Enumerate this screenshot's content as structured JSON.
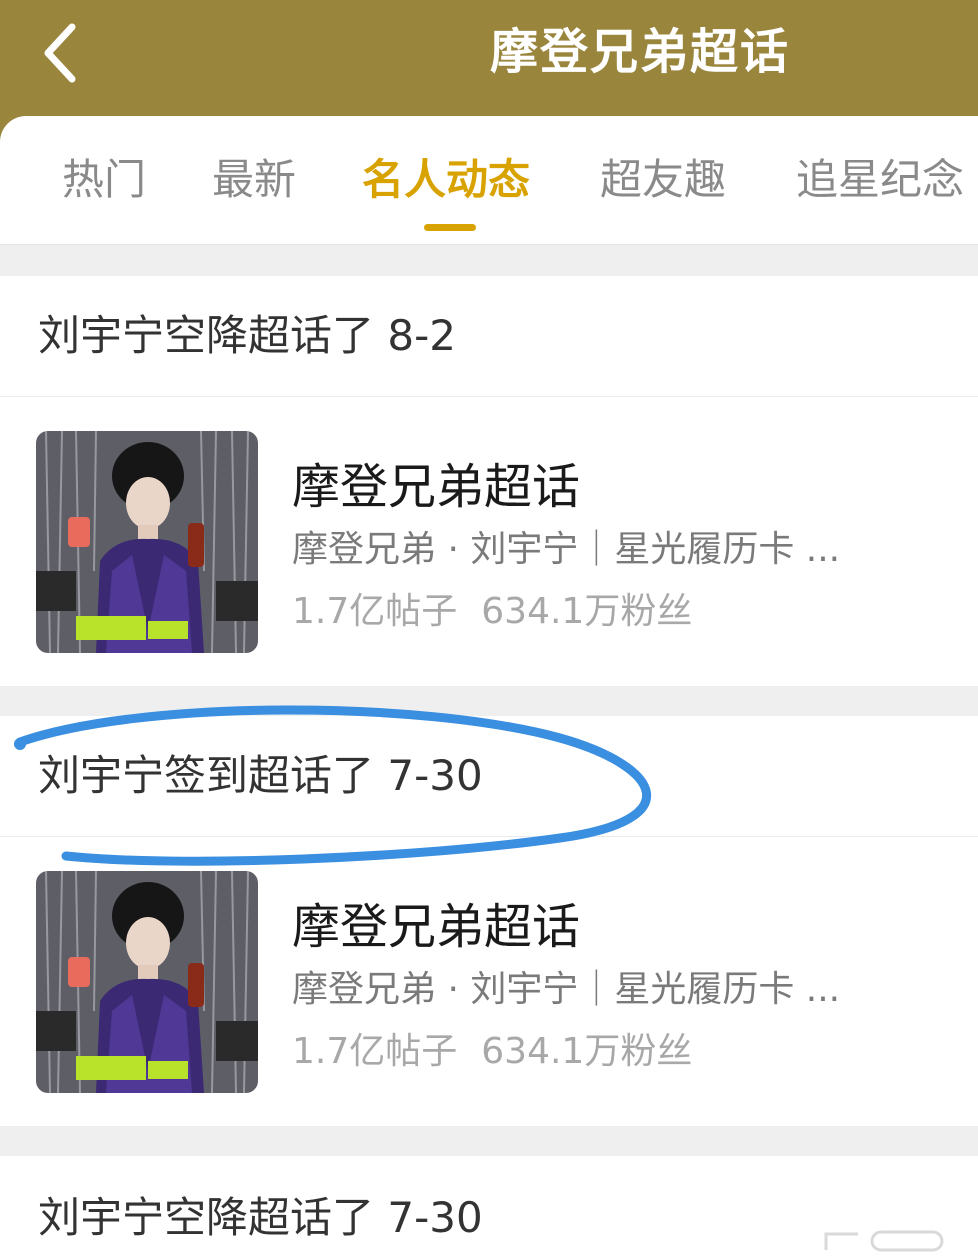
{
  "header": {
    "title": "摩登兄弟超话"
  },
  "tabs": [
    {
      "label": "热门"
    },
    {
      "label": "最新"
    },
    {
      "label": "名人动态"
    },
    {
      "label": "超友趣"
    },
    {
      "label": "追星纪念"
    }
  ],
  "active_tab": "名人动态",
  "sections": [
    {
      "heading": "刘宇宁空降超话了 8-2",
      "item": {
        "title": "摩登兄弟超话",
        "subtitle": "摩登兄弟 · 刘宇宁｜星光履历卡 ...",
        "posts": "1.7亿帖子",
        "fans": "634.1万粉丝"
      }
    },
    {
      "heading": "刘宇宁签到超话了 7-30",
      "item": {
        "title": "摩登兄弟超话",
        "subtitle": "摩登兄弟 · 刘宇宁｜星光履历卡 ...",
        "posts": "1.7亿帖子",
        "fans": "634.1万粉丝"
      }
    },
    {
      "heading": "刘宇宁空降超话了 7-30"
    }
  ],
  "colors": {
    "header_bg": "#9a853d",
    "accent": "#d8a200",
    "annotation_stroke": "#3a8fe0"
  },
  "icons": {
    "back": "chevron-left-icon"
  }
}
